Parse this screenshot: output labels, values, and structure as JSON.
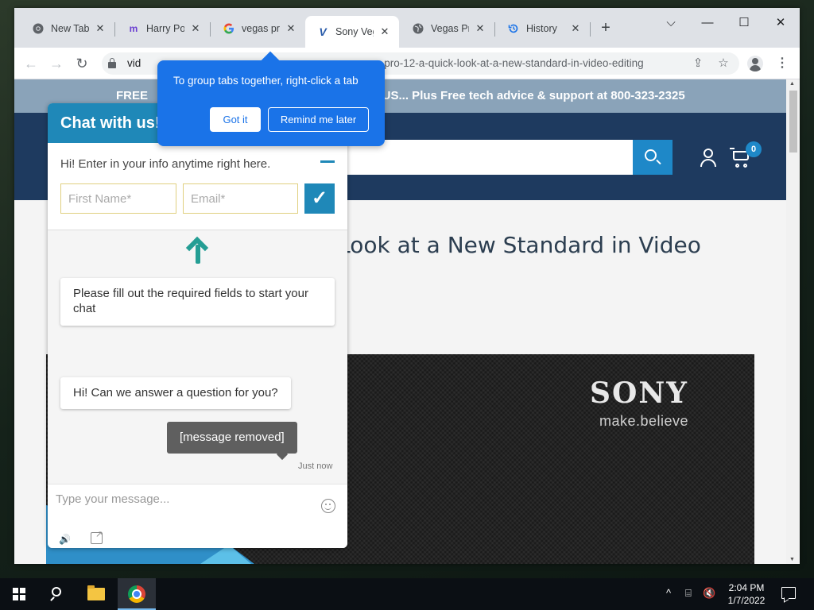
{
  "browser": {
    "tabs": [
      {
        "title": "New Tab",
        "favicon": "chrome-icon",
        "close": "✕"
      },
      {
        "title": "Harry Potter",
        "favicon": "m-icon",
        "close": "✕"
      },
      {
        "title": "vegas pro",
        "favicon": "google-icon",
        "close": "✕"
      },
      {
        "title": "Sony Vegas",
        "favicon": "v-icon",
        "close": "✕",
        "active": true
      },
      {
        "title": "Vegas Pro",
        "favicon": "globe-icon",
        "close": "✕"
      },
      {
        "title": "History",
        "favicon": "history-icon",
        "close": "✕"
      }
    ],
    "new_tab_symbol": "+",
    "window_controls": {
      "chevron": "⌵",
      "minimize": "—",
      "maximize": "☐",
      "close": "✕"
    },
    "address": {
      "url_start": "vid",
      "url_end": "s-pro-12-a-quick-look-at-a-new-standard-in-video-editing"
    },
    "nav": {
      "back": "←",
      "forward": "→",
      "reload": "↻"
    },
    "omni_icons": {
      "share": "⇪",
      "bookmark": "☆"
    },
    "menu_symbol": "⋮"
  },
  "tab_group_popup": {
    "message": "To group tabs together, right-click a tab",
    "got_it": "Got it",
    "remind_later": "Remind me later"
  },
  "site": {
    "promo_left": "FREE",
    "promo_right": "al US... Plus Free tech advice & support at 800-323-2325",
    "cart_count": "0",
    "article_title": "k Look at a New Standard in Video",
    "hero": {
      "brand": "SONY",
      "tagline": "make.believe"
    }
  },
  "chat": {
    "header_title": "Chat with us!",
    "prompt": "Hi! Enter in your info anytime right here.",
    "first_name_placeholder": "First Name*",
    "email_placeholder": "Email*",
    "submit_symbol": "✓",
    "required_notice": "Please fill out the required fields to start your chat",
    "greeting": "Hi! Can we answer a question for you?",
    "user_message": "[message removed]",
    "timestamp": "Just now",
    "composer_placeholder": "Type your message...",
    "sound_symbol": "🔊"
  },
  "taskbar": {
    "time": "2:04 PM",
    "date": "1/7/2022",
    "tray": {
      "chevron": "^",
      "network": "⌸",
      "volume": "🔇"
    }
  },
  "colors": {
    "chat_accent": "#1f88b8",
    "site_header": "#1e3a5f",
    "promo_bar": "#8aa3b9",
    "popup_blue": "#1a73e8"
  }
}
